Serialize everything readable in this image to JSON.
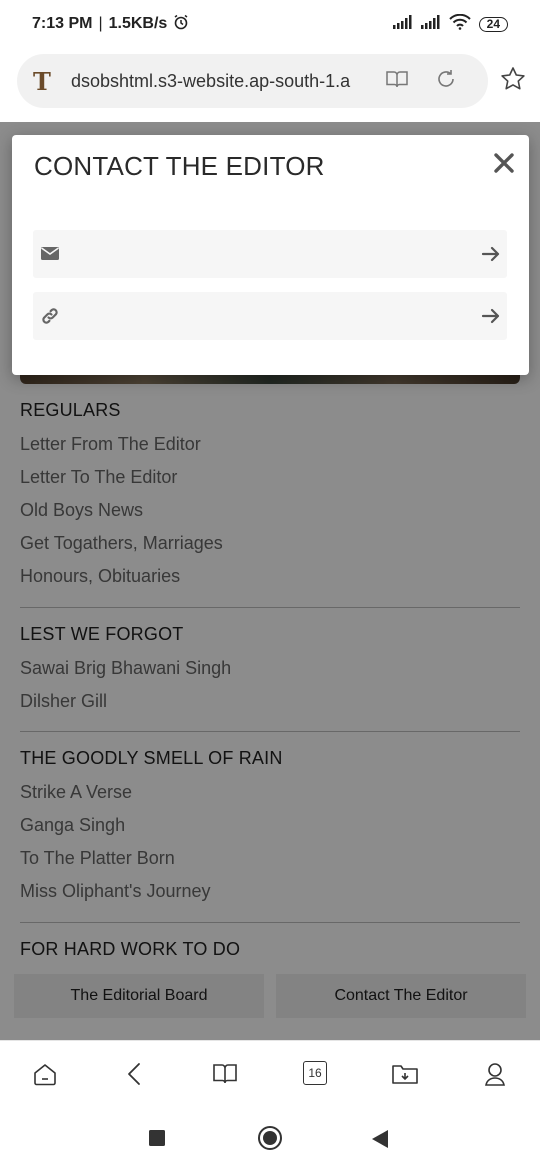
{
  "status_bar": {
    "time": "7:13 PM",
    "separator": "|",
    "net_speed": "1.5KB/s",
    "battery": "24"
  },
  "browser": {
    "site_icon": "T",
    "url": "dsobshtml.s3-website.ap-south-1.a",
    "tab_count": "16"
  },
  "page": {
    "sections": [
      {
        "heading": "REGULARS",
        "items": [
          "Letter From The Editor",
          "Letter To The Editor",
          "Old Boys News",
          "Get Togathers, Marriages",
          "Honours, Obituaries"
        ]
      },
      {
        "heading": "LEST WE FORGOT",
        "items": [
          "Sawai Brig Bhawani Singh",
          "Dilsher Gill"
        ]
      },
      {
        "heading": "THE GOODLY SMELL OF RAIN",
        "items": [
          "Strike A Verse",
          "Ganga Singh",
          "To The Platter Born",
          "Miss Oliphant's Journey"
        ]
      },
      {
        "heading": "FOR HARD WORK TO DO",
        "items": []
      }
    ],
    "footer_buttons": [
      "The Editorial Board",
      "Contact The Editor"
    ]
  },
  "modal": {
    "title": "CONTACT THE EDITOR",
    "rows": [
      {
        "icon": "envelope-icon"
      },
      {
        "icon": "link-icon"
      }
    ]
  },
  "colors": {
    "overlay": "rgba(0,0,0,0.45)",
    "modal_bg": "#ffffff",
    "row_bg": "#f6f6f6"
  }
}
